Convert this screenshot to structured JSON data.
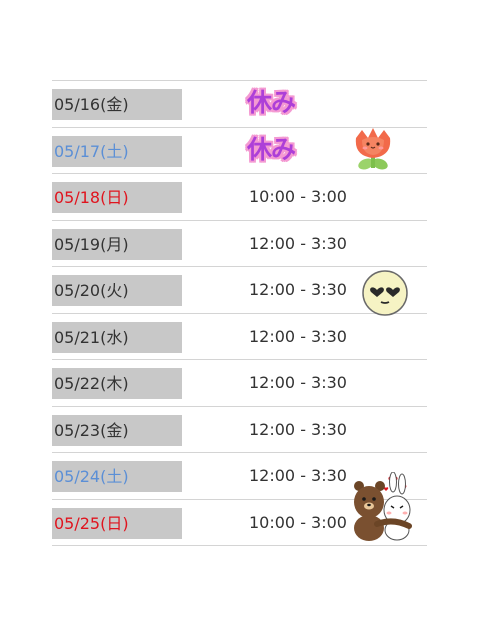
{
  "schedule": {
    "rows": [
      {
        "date": "05/16(金)",
        "day_type": "weekday",
        "hours": "休み",
        "closed": true
      },
      {
        "date": "05/17(土)",
        "day_type": "saturday",
        "hours": "休み",
        "closed": true
      },
      {
        "date": "05/18(日)",
        "day_type": "sunday",
        "hours": "10:00 - 3:00",
        "closed": false
      },
      {
        "date": "05/19(月)",
        "day_type": "weekday",
        "hours": "12:00 - 3:30",
        "closed": false
      },
      {
        "date": "05/20(火)",
        "day_type": "weekday",
        "hours": "12:00 - 3:30",
        "closed": false
      },
      {
        "date": "05/21(水)",
        "day_type": "weekday",
        "hours": "12:00 - 3:30",
        "closed": false
      },
      {
        "date": "05/22(木)",
        "day_type": "weekday",
        "hours": "12:00 - 3:30",
        "closed": false
      },
      {
        "date": "05/23(金)",
        "day_type": "weekday",
        "hours": "12:00 - 3:30",
        "closed": false
      },
      {
        "date": "05/24(土)",
        "day_type": "saturday",
        "hours": "12:00 - 3:30",
        "closed": false
      },
      {
        "date": "05/25(日)",
        "day_type": "sunday",
        "hours": "10:00 - 3:00",
        "closed": false
      }
    ]
  },
  "stickers": [
    "tulip-sticker",
    "heart-eyes-smiley-sticker",
    "bear-and-bunny-hug-sticker"
  ],
  "colors": {
    "date_background": "#c8c8c8",
    "saturday_text": "#5b8fd6",
    "sunday_text": "#e0141e",
    "holiday_text": "#ad3fd8",
    "holiday_outline": "#f49ad2",
    "divider": "#d4d4d4"
  }
}
